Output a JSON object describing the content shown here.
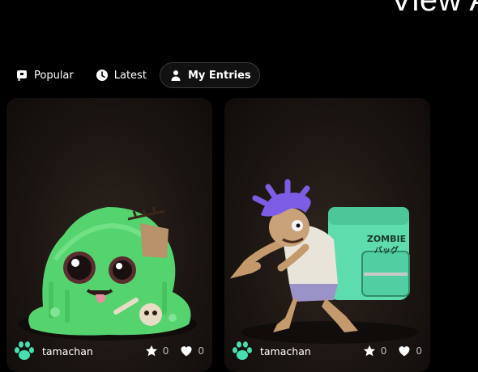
{
  "header": {
    "title_fragment": "View A"
  },
  "tabs": [
    {
      "label": "Popular",
      "icon": "flag-icon"
    },
    {
      "label": "Latest",
      "icon": "clock-icon"
    },
    {
      "label": "My Entries",
      "icon": "user-icon",
      "active": true
    }
  ],
  "cards": [
    {
      "author": "tamachan",
      "stars": "0",
      "likes": "0",
      "art": "green-slime-zombie"
    },
    {
      "author": "tamachan",
      "stars": "0",
      "likes": "0",
      "art": "zombie-delivery-runner",
      "bag_text": "ZOMBIE\nバッグ"
    }
  ],
  "colors": {
    "accent": "#46e0b0",
    "card_bg": "#1f1814",
    "tab_active_border": "#3a3a3a"
  }
}
